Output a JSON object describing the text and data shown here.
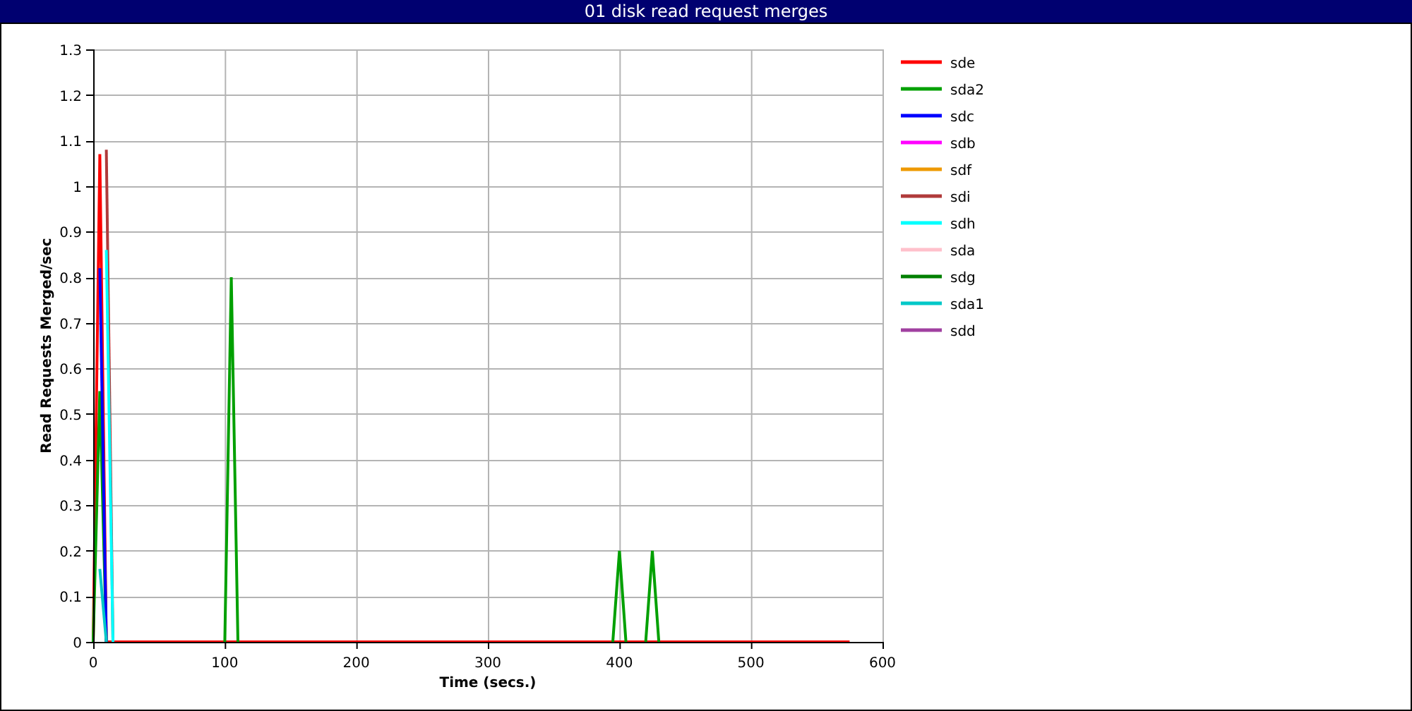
{
  "window": {
    "title": "01 disk read request merges"
  },
  "chart_data": {
    "type": "line",
    "xlabel": "Time (secs.)",
    "ylabel": "Read Requests Merged/sec",
    "x": [
      0,
      5,
      10,
      15,
      100,
      105,
      110,
      200,
      395,
      400,
      405,
      410,
      420,
      425,
      430,
      575
    ],
    "xlim": [
      0,
      600
    ],
    "ylim": [
      0,
      1.3
    ],
    "xticks": [
      0,
      100,
      200,
      300,
      400,
      500,
      600
    ],
    "yticks": [
      0,
      0.1,
      0.2,
      0.3,
      0.4,
      0.5,
      0.6,
      0.7,
      0.8,
      0.9,
      1,
      1.1,
      1.2,
      1.3
    ],
    "grid": true,
    "legend": true,
    "series": [
      {
        "name": "sde",
        "color": "#ff0000",
        "values": [
          0,
          1.07,
          0,
          0,
          0,
          0,
          0,
          0,
          0,
          0,
          0,
          0,
          0,
          0,
          0,
          0
        ]
      },
      {
        "name": "sda2",
        "color": "#00a000",
        "values": [
          0,
          0.55,
          0,
          null,
          0,
          0.8,
          0,
          null,
          0,
          0.2,
          0,
          null,
          0,
          0.2,
          0,
          null
        ]
      },
      {
        "name": "sdc",
        "color": "#0000ff",
        "values": [
          null,
          0.82,
          0,
          null,
          null,
          null,
          null,
          null,
          null,
          null,
          null,
          null,
          null,
          null,
          null,
          null
        ]
      },
      {
        "name": "sdb",
        "color": "#ff00ff",
        "values": [
          null,
          null,
          null,
          null,
          null,
          null,
          null,
          null,
          null,
          null,
          null,
          null,
          null,
          null,
          null,
          null
        ]
      },
      {
        "name": "sdf",
        "color": "#ee9900",
        "values": [
          null,
          null,
          null,
          null,
          null,
          null,
          null,
          null,
          null,
          null,
          null,
          null,
          null,
          null,
          null,
          null
        ]
      },
      {
        "name": "sdi",
        "color": "#b03a3a",
        "values": [
          null,
          null,
          1.08,
          0,
          null,
          null,
          null,
          null,
          null,
          null,
          null,
          null,
          null,
          null,
          null,
          null
        ]
      },
      {
        "name": "sdh",
        "color": "#00ffff",
        "values": [
          null,
          null,
          0.86,
          0,
          null,
          null,
          null,
          null,
          null,
          null,
          null,
          null,
          null,
          null,
          null,
          null
        ]
      },
      {
        "name": "sda",
        "color": "#ffc0cb",
        "values": [
          null,
          null,
          null,
          null,
          null,
          null,
          null,
          null,
          null,
          null,
          null,
          null,
          null,
          null,
          null,
          null
        ]
      },
      {
        "name": "sdg",
        "color": "#008000",
        "values": [
          null,
          null,
          null,
          null,
          null,
          null,
          null,
          null,
          null,
          null,
          null,
          null,
          null,
          null,
          null,
          null
        ]
      },
      {
        "name": "sda1",
        "color": "#00c8c8",
        "values": [
          null,
          0.16,
          0,
          null,
          null,
          null,
          null,
          null,
          null,
          null,
          null,
          null,
          null,
          null,
          null,
          null
        ]
      },
      {
        "name": "sdd",
        "color": "#a040a0",
        "values": [
          null,
          null,
          null,
          null,
          null,
          null,
          null,
          null,
          null,
          null,
          null,
          null,
          null,
          null,
          null,
          null
        ]
      }
    ]
  }
}
